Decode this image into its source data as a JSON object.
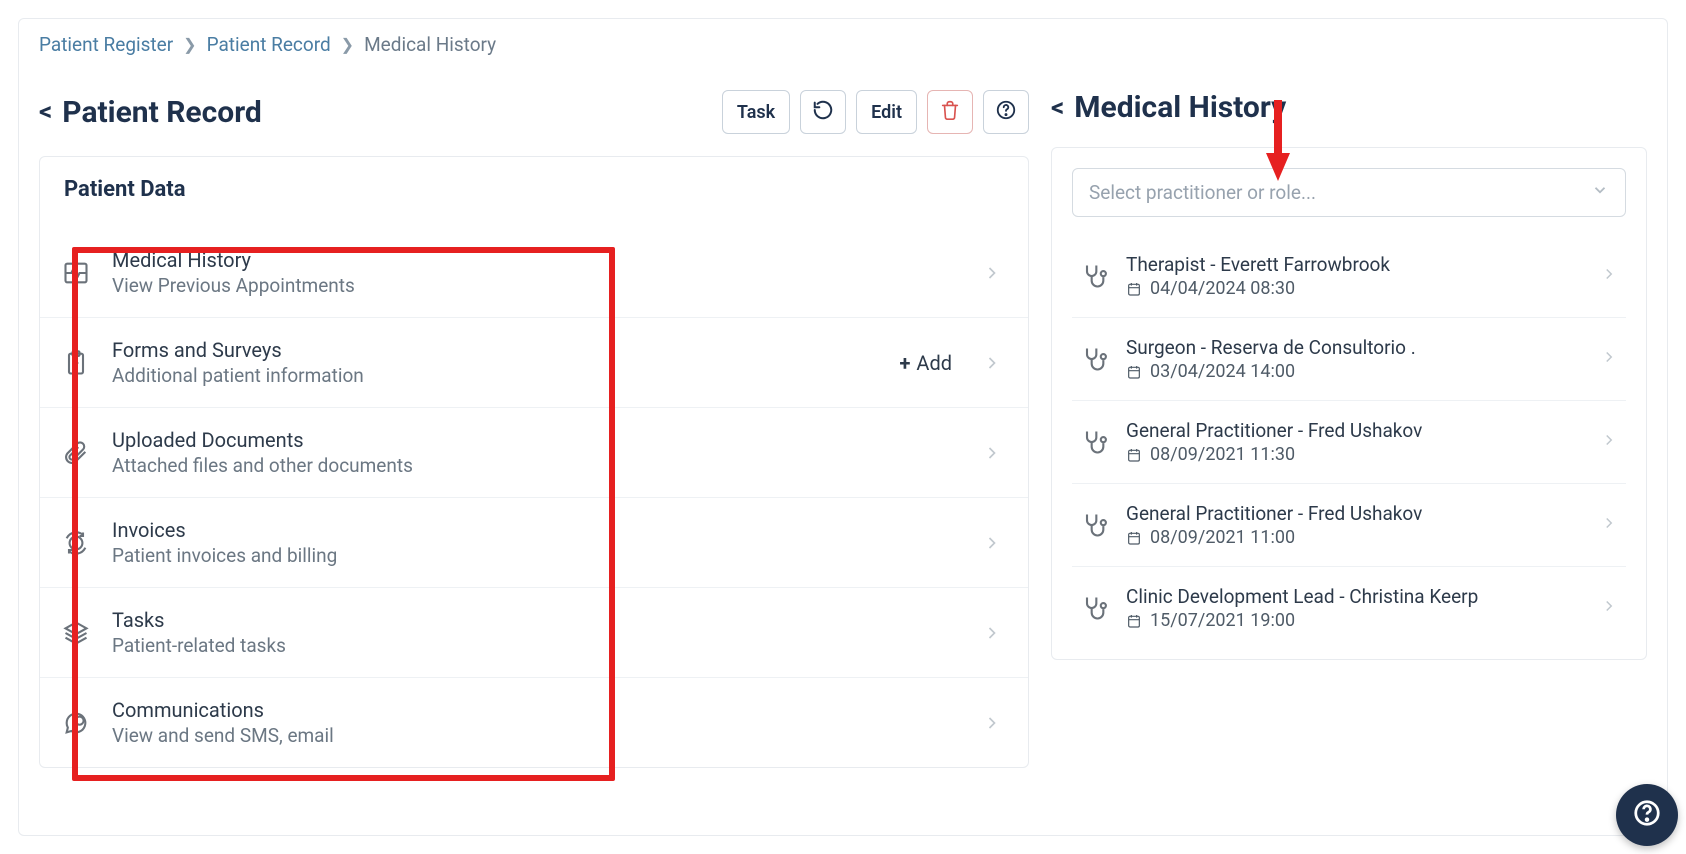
{
  "breadcrumb": {
    "item1": "Patient Register",
    "item2": "Patient Record",
    "item3": "Medical History"
  },
  "left_panel": {
    "title": "Patient Record",
    "toolbar": {
      "task": "Task",
      "edit": "Edit"
    },
    "card_title": "Patient Data",
    "items": [
      {
        "title": "Medical History",
        "sub": "View Previous Appointments"
      },
      {
        "title": "Forms and Surveys",
        "sub": "Additional patient information",
        "add_label": "Add"
      },
      {
        "title": "Uploaded Documents",
        "sub": "Attached files and other documents"
      },
      {
        "title": "Invoices",
        "sub": "Patient invoices and billing"
      },
      {
        "title": "Tasks",
        "sub": "Patient-related tasks"
      },
      {
        "title": "Communications",
        "sub": "View and send SMS, email"
      }
    ]
  },
  "right_panel": {
    "title": "Medical History",
    "select_placeholder": "Select practitioner or role...",
    "history": [
      {
        "title": "Therapist - Everett Farrowbrook",
        "date": "04/04/2024 08:30"
      },
      {
        "title": "Surgeon - Reserva de Consultorio .",
        "date": "03/04/2024 14:00"
      },
      {
        "title": "General Practitioner - Fred Ushakov",
        "date": "08/09/2021 11:30"
      },
      {
        "title": "General Practitioner - Fred Ushakov",
        "date": "08/09/2021 11:00"
      },
      {
        "title": "Clinic Development Lead - Christina Keerp",
        "date": "15/07/2021 19:00"
      }
    ]
  }
}
